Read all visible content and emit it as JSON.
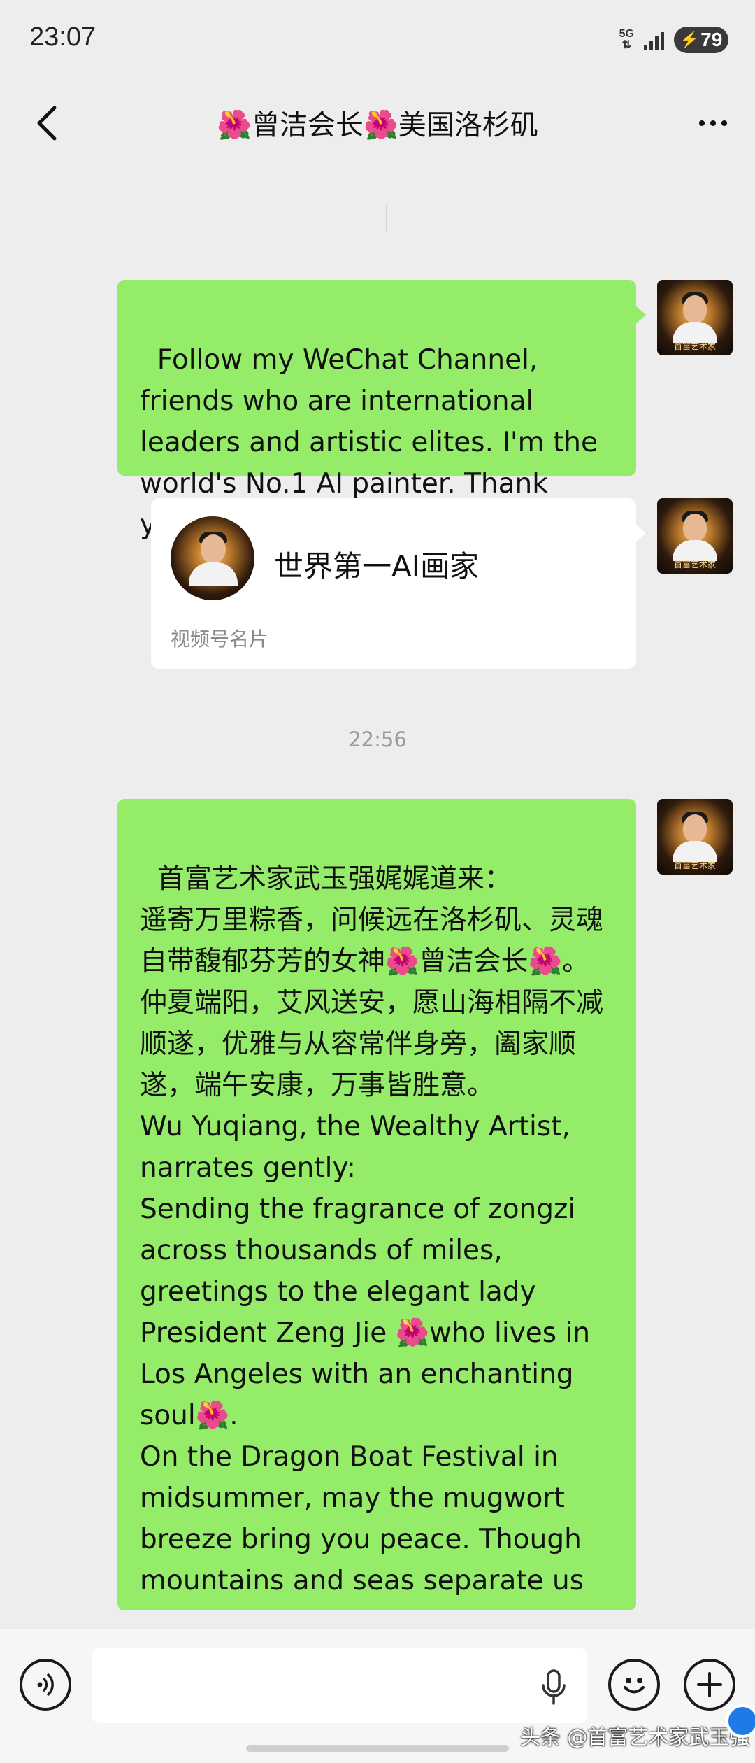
{
  "status_bar": {
    "time": "23:07",
    "network": "5G",
    "battery": "79"
  },
  "header": {
    "title": "🌺曾洁会长🌺美国洛杉矶"
  },
  "messages": [
    {
      "type": "text",
      "sender": "self",
      "text": "Follow my WeChat Channel, friends who are international leaders and artistic elites. I'm the world's No.1 AI painter. Thank you!"
    },
    {
      "type": "channel_card",
      "sender": "self",
      "name": "世界第一AI画家",
      "label": "视频号名片"
    },
    {
      "type": "time",
      "text": "22:56"
    },
    {
      "type": "text",
      "sender": "self",
      "text": "首富艺术家武玉强娓娓道来：\n遥寄万里粽香，问候远在洛杉矶、灵魂自带馥郁芬芳的女神🌺曾洁会长🌺。\n仲夏端阳，艾风送安，愿山海相隔不减顺遂，优雅与从容常伴身旁，阖家顺遂，端午安康，万事皆胜意。\nWu Yuqiang, the Wealthy Artist, narrates gently:\nSending the fragrance of zongzi across thousands of miles, greetings to the elegant lady President Zeng Jie 🌺who lives in Los Angeles with an enchanting soul🌺.\nOn the Dragon Boat Festival in midsummer, may the mugwort breeze bring you peace. Though mountains and seas separate us"
    }
  ],
  "avatar_caption": "首富艺术家",
  "input": {
    "value": "",
    "placeholder": ""
  },
  "watermark": "头条 @首富艺术家武玉强",
  "icons": {
    "back": "back-arrow-icon",
    "more": "more-dots-icon",
    "voice": "voice-icon",
    "mic": "mic-icon",
    "emoji": "emoji-icon",
    "plus": "plus-icon"
  },
  "colors": {
    "background": "#ededed",
    "bubble_self": "#95ec69",
    "card_bg": "#ffffff",
    "timestamp": "#9b9b9b",
    "input_bar": "#f6f6f6"
  }
}
